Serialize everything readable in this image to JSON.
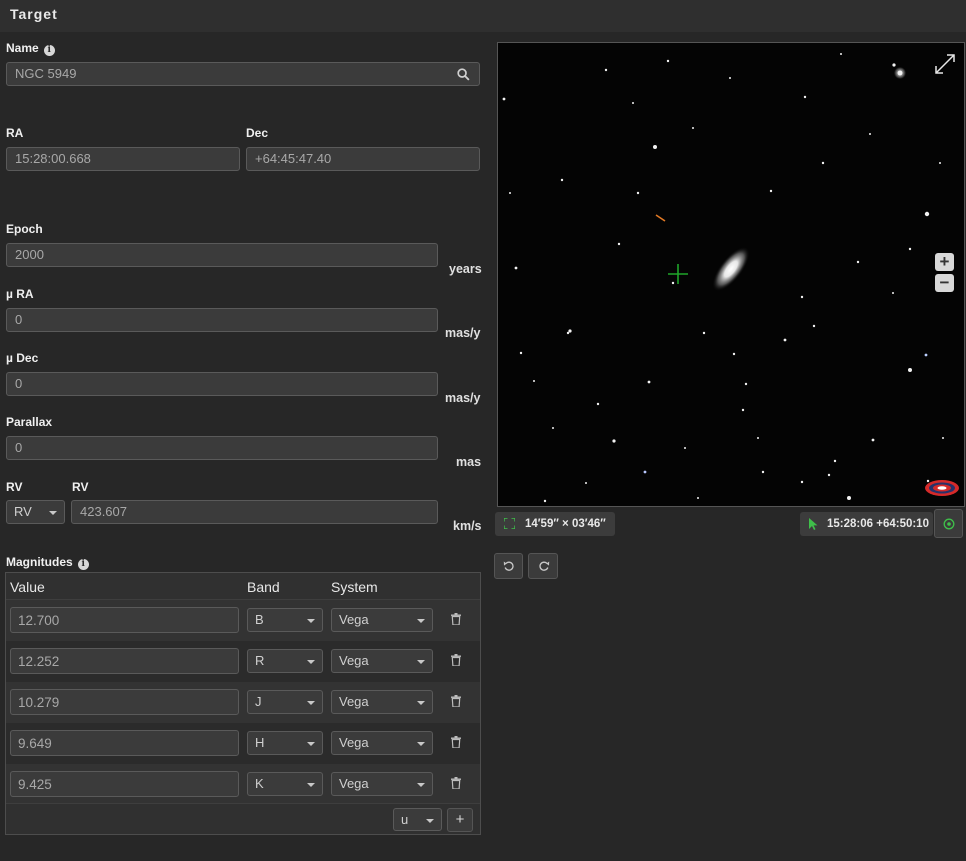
{
  "header": {
    "title": "Target"
  },
  "name": {
    "label": "Name",
    "value": "NGC 5949"
  },
  "ra": {
    "label": "RA",
    "value": "15:28:00.668"
  },
  "dec": {
    "label": "Dec",
    "value": "+64:45:47.40"
  },
  "epoch": {
    "label": "Epoch",
    "value": "2000",
    "unit": "years"
  },
  "pm_ra": {
    "label": "µ RA",
    "value": "0",
    "unit": "mas/y"
  },
  "pm_dec": {
    "label": "µ Dec",
    "value": "0",
    "unit": "mas/y"
  },
  "parallax": {
    "label": "Parallax",
    "value": "0",
    "unit": "mas"
  },
  "rv": {
    "label_type": "RV",
    "label_value": "RV",
    "type": "RV",
    "value": "423.607",
    "unit": "km/s"
  },
  "magnitudes": {
    "label": "Magnitudes",
    "columns": [
      "Value",
      "Band",
      "System"
    ],
    "rows": [
      {
        "value": "12.700",
        "band": "B",
        "system": "Vega"
      },
      {
        "value": "12.252",
        "band": "R",
        "system": "Vega"
      },
      {
        "value": "10.279",
        "band": "J",
        "system": "Vega"
      },
      {
        "value": "9.649",
        "band": "H",
        "system": "Vega"
      },
      {
        "value": "9.425",
        "band": "K",
        "system": "Vega"
      }
    ],
    "new_band": "u",
    "add_label": "+"
  },
  "viewer": {
    "fov": "14′59″ × 03′46″",
    "cursor_coords": "15:28:06 +64:50:10",
    "zoom_in": "+",
    "zoom_out": "−"
  },
  "colors": {
    "accent_green": "#3fbf4a",
    "crosshair": "#1fa52a"
  }
}
